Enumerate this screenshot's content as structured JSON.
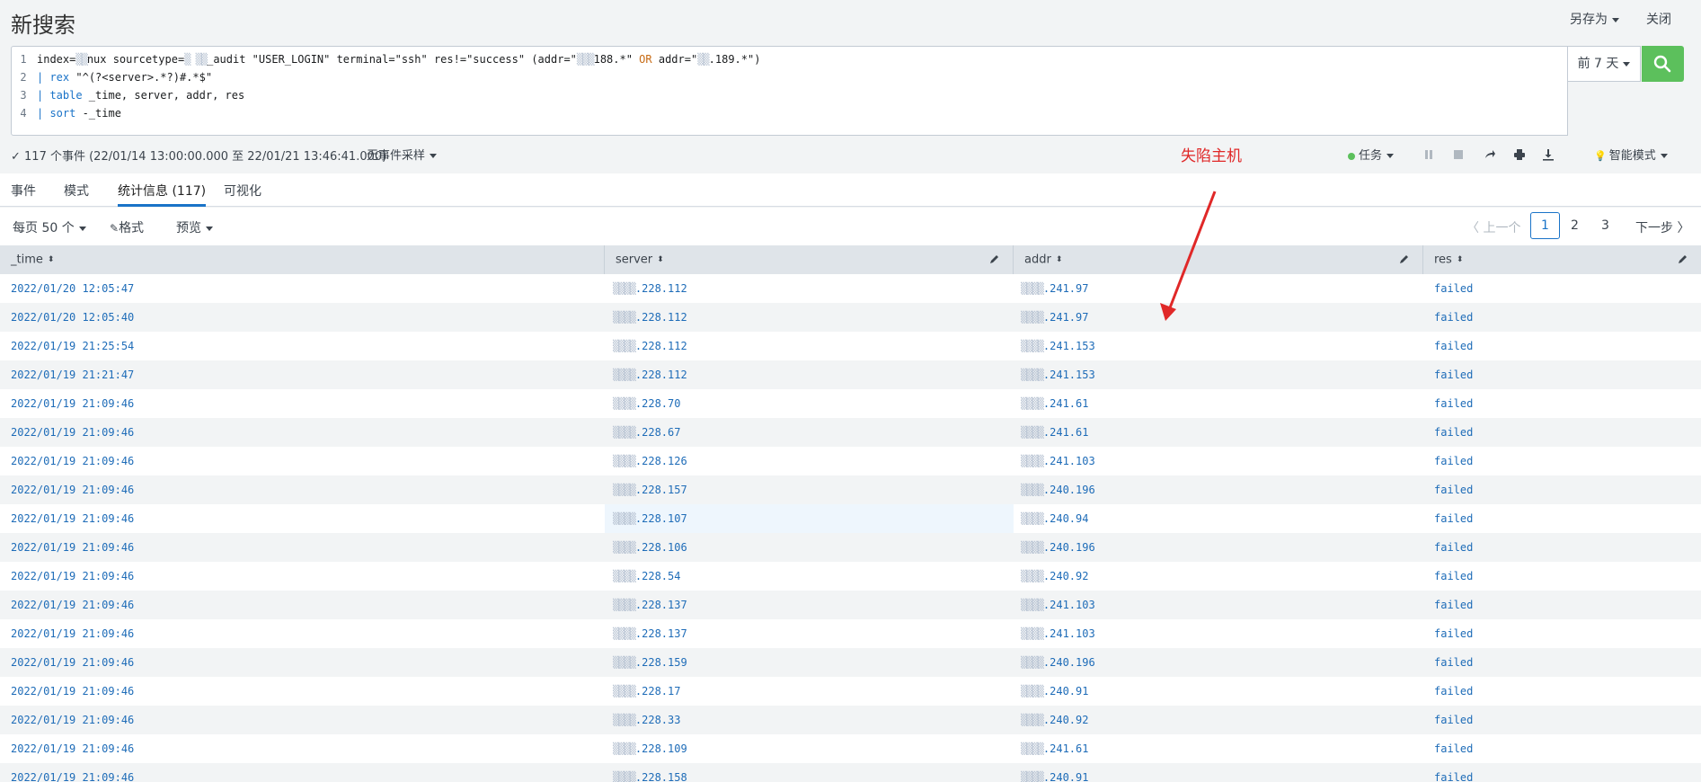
{
  "header": {
    "title": "新搜索",
    "save_as": "另存为",
    "close": "关闭"
  },
  "search": {
    "lines": [
      {
        "n": "1",
        "parts": [
          {
            "t": "index=",
            "c": ""
          },
          {
            "t": "▒▒",
            "c": "blur"
          },
          {
            "t": "nux sourcetype=",
            "c": ""
          },
          {
            "t": "▒ ▒▒",
            "c": "blur"
          },
          {
            "t": "_audit \"USER_LOGIN\" terminal=\"ssh\" res!=\"success\" (addr=\"",
            "c": ""
          },
          {
            "t": "▒▒▒",
            "c": "blur"
          },
          {
            "t": "188.*\" ",
            "c": ""
          },
          {
            "t": "OR",
            "c": "op"
          },
          {
            "t": " addr=\"",
            "c": ""
          },
          {
            "t": "▒▒",
            "c": "blur"
          },
          {
            "t": ".189.*\")",
            "c": ""
          }
        ]
      },
      {
        "n": "2",
        "parts": [
          {
            "t": "| ",
            "c": "kw"
          },
          {
            "t": "rex",
            "c": "kw"
          },
          {
            "t": " \"^(?<server>.*?)#.*$\"",
            "c": ""
          }
        ]
      },
      {
        "n": "3",
        "parts": [
          {
            "t": "| ",
            "c": "kw"
          },
          {
            "t": "table",
            "c": "kw"
          },
          {
            "t": " _time, server, addr, res",
            "c": ""
          }
        ]
      },
      {
        "n": "4",
        "parts": [
          {
            "t": "| ",
            "c": "kw"
          },
          {
            "t": "sort",
            "c": "kw"
          },
          {
            "t": " -_time",
            "c": ""
          }
        ]
      }
    ],
    "time_range": "前 7 天"
  },
  "status": {
    "summary": "✓ 117 个事件 (22/01/14 13:00:00.000 至 22/01/21 13:46:41.000)",
    "sampling": "无事件采样",
    "job": "任务",
    "mode": "智能模式"
  },
  "annotation": "失陷主机",
  "tabs": [
    {
      "label": "事件",
      "active": false
    },
    {
      "label": "模式",
      "active": false
    },
    {
      "label": "统计信息 (117)",
      "active": true
    },
    {
      "label": "可视化",
      "active": false
    }
  ],
  "toolbar": {
    "per_page": "每页 50 个",
    "format": "格式",
    "preview": "预览"
  },
  "pager": {
    "prev": "〈 上一个",
    "pages": [
      "1",
      "2",
      "3"
    ],
    "current": "1",
    "next": "下一步 〉"
  },
  "table": {
    "columns": [
      "_time",
      "server",
      "addr",
      "res"
    ],
    "rows": [
      [
        "2022/01/20 12:05:47",
        ".228.112",
        ".241.97",
        "failed"
      ],
      [
        "2022/01/20 12:05:40",
        ".228.112",
        ".241.97",
        "failed"
      ],
      [
        "2022/01/19 21:25:54",
        ".228.112",
        ".241.153",
        "failed"
      ],
      [
        "2022/01/19 21:21:47",
        ".228.112",
        ".241.153",
        "failed"
      ],
      [
        "2022/01/19 21:09:46",
        ".228.70",
        ".241.61",
        "failed"
      ],
      [
        "2022/01/19 21:09:46",
        ".228.67",
        ".241.61",
        "failed"
      ],
      [
        "2022/01/19 21:09:46",
        ".228.126",
        ".241.103",
        "failed"
      ],
      [
        "2022/01/19 21:09:46",
        ".228.157",
        ".240.196",
        "failed"
      ],
      [
        "2022/01/19 21:09:46",
        ".228.107",
        ".240.94",
        "failed"
      ],
      [
        "2022/01/19 21:09:46",
        ".228.106",
        ".240.196",
        "failed"
      ],
      [
        "2022/01/19 21:09:46",
        ".228.54",
        ".240.92",
        "failed"
      ],
      [
        "2022/01/19 21:09:46",
        ".228.137",
        ".241.103",
        "failed"
      ],
      [
        "2022/01/19 21:09:46",
        ".228.137",
        ".241.103",
        "failed"
      ],
      [
        "2022/01/19 21:09:46",
        ".228.159",
        ".240.196",
        "failed"
      ],
      [
        "2022/01/19 21:09:46",
        ".228.17",
        ".240.91",
        "failed"
      ],
      [
        "2022/01/19 21:09:46",
        ".228.33",
        ".240.92",
        "failed"
      ],
      [
        "2022/01/19 21:09:46",
        ".228.109",
        ".241.61",
        "failed"
      ],
      [
        "2022/01/19 21:09:46",
        ".228.158",
        ".240.91",
        "failed"
      ]
    ]
  },
  "colors": {
    "accent": "#1a73c8",
    "search_button": "#5cc05c",
    "annotation": "#e02828"
  }
}
